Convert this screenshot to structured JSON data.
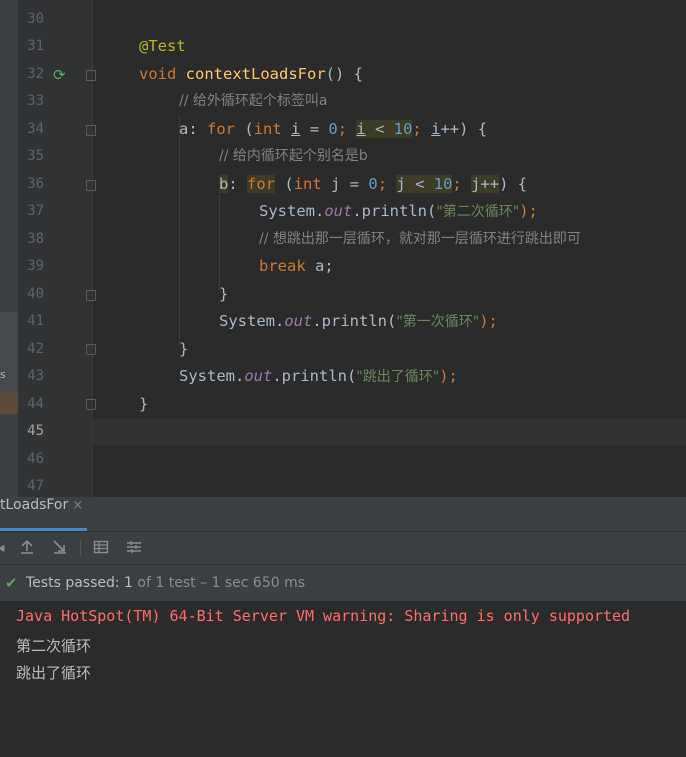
{
  "editor": {
    "line_numbers": [
      "30",
      "31",
      "32",
      "33",
      "34",
      "35",
      "36",
      "37",
      "38",
      "39",
      "40",
      "41",
      "42",
      "43",
      "44",
      "45",
      "46",
      "47"
    ],
    "current_line": "45",
    "code": {
      "l31": {
        "annotation": "@Test"
      },
      "l32": {
        "kw_void": "void",
        "method": "contextLoadsFor",
        "rest": "() {"
      },
      "l33": {
        "comment": "// 给外循环起个标签叫a"
      },
      "l34": {
        "label": "a:",
        "kw_for": "for",
        "p1": " (",
        "kw_int": "int",
        "sp": " ",
        "var_i": "i",
        "eq": " = ",
        "zero": "0",
        "semi1": ";",
        "sp2": " ",
        "cond_i": "i",
        "lt": " < ",
        "ten": "10",
        "semi2": ";",
        "sp3": " ",
        "inc_i": "i",
        "inc": "++) {"
      },
      "l35": {
        "comment": "// 给内循环起个别名是b"
      },
      "l36": {
        "label": "b",
        "colon": ":",
        "kw_for": "for",
        "p1": " (",
        "kw_int": "int",
        "rest1": " j = ",
        "zero": "0",
        "semi1": ";",
        "sp": " ",
        "cond": "j < ",
        "ten": "10",
        "semi2": ";",
        "sp2": " ",
        "inc": "j++",
        "close": ") {"
      },
      "l37": {
        "sys": "System.",
        "out": "out",
        "println": ".println(",
        "str": "\"第二次循环\"",
        "end": ");"
      },
      "l38": {
        "comment": "// 想跳出那一层循环，就对那一层循环进行跳出即可"
      },
      "l39": {
        "kw_break": "break",
        "rest": " a;"
      },
      "l40": {
        "brace": "}"
      },
      "l41": {
        "sys": "System.",
        "out": "out",
        "println": ".println(",
        "str": "\"第一次循环\"",
        "end": ");"
      },
      "l42": {
        "brace": "}"
      },
      "l43": {
        "sys": "System.",
        "out": "out",
        "println": ".println(",
        "str": "\"跳出了循环\"",
        "end": ");"
      },
      "l44": {
        "brace": "}"
      }
    },
    "left_strip_text": "s"
  },
  "run_panel": {
    "tab_label": "tLoadsFor",
    "tab_close": "×",
    "toolbar_icons": [
      "rerun-icon",
      "export-icon",
      "import-icon",
      "table-icon",
      "settings-icon"
    ],
    "status": {
      "label": "Tests passed: ",
      "count": "1",
      "rest": " of 1 test – 1 sec 650 ms"
    },
    "console": [
      "Java HotSpot(TM) 64-Bit Server VM warning: Sharing is only supported",
      "第二次循环",
      "跳出了循环"
    ]
  },
  "colors": {
    "background": "#2b2b2b",
    "keyword": "#cc7832",
    "string": "#6a8759",
    "number": "#6897bb",
    "comment": "#808080",
    "error": "#ff6b68",
    "pass": "#5aa55a"
  }
}
